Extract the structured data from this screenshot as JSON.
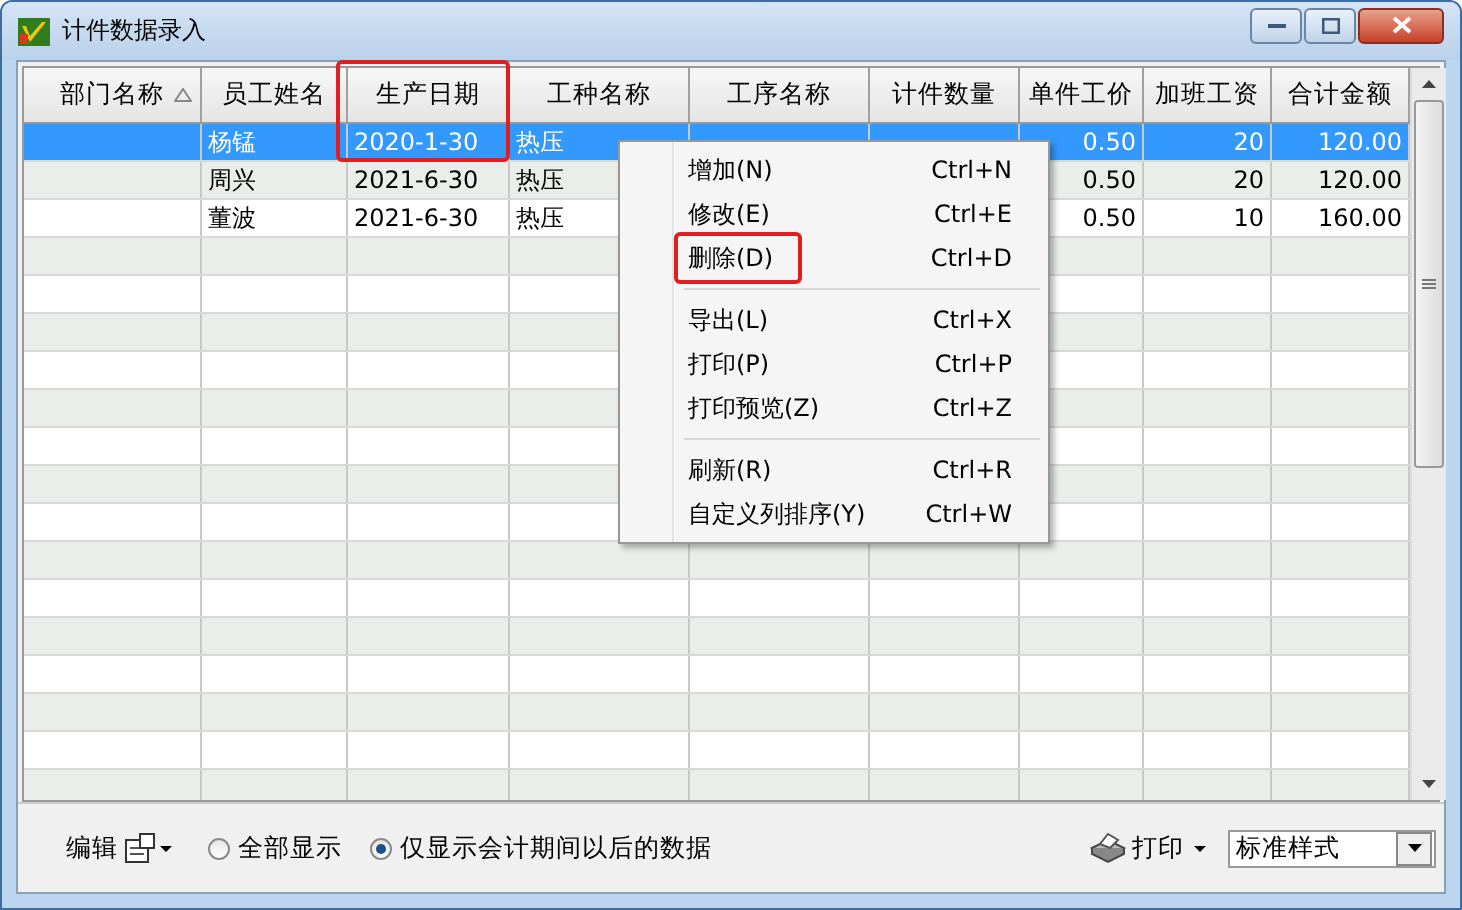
{
  "window": {
    "title": "计件数据录入"
  },
  "table": {
    "columns": [
      {
        "label": "部门名称",
        "sorted": true,
        "highlighted": false
      },
      {
        "label": "员工姓名",
        "sorted": false,
        "highlighted": false
      },
      {
        "label": "生产日期",
        "sorted": false,
        "highlighted": true
      },
      {
        "label": "工种名称",
        "sorted": false,
        "highlighted": false
      },
      {
        "label": "工序名称",
        "sorted": false,
        "highlighted": false
      },
      {
        "label": "计件数量",
        "sorted": false,
        "highlighted": false
      },
      {
        "label": "单件工价",
        "sorted": false,
        "highlighted": false
      },
      {
        "label": "加班工资",
        "sorted": false,
        "highlighted": false
      },
      {
        "label": "合计金额",
        "sorted": false,
        "highlighted": false
      }
    ],
    "rows": [
      {
        "selected": true,
        "cells": [
          null,
          "杨锰",
          "2020-1-30",
          "热压",
          null,
          null,
          "0.50",
          "20",
          "120.00"
        ]
      },
      {
        "selected": false,
        "cells": [
          null,
          "周兴",
          "2021-6-30",
          "热压",
          null,
          null,
          "0.50",
          "20",
          "120.00"
        ]
      },
      {
        "selected": false,
        "cells": [
          null,
          "董波",
          "2021-6-30",
          "热压",
          null,
          null,
          "0.50",
          "10",
          "160.00"
        ]
      }
    ]
  },
  "context_menu": {
    "groups": [
      [
        {
          "label": "增加(N)",
          "shortcut": "Ctrl+N",
          "highlighted": false
        },
        {
          "label": "修改(E)",
          "shortcut": "Ctrl+E",
          "highlighted": false
        },
        {
          "label": "删除(D)",
          "shortcut": "Ctrl+D",
          "highlighted": true
        }
      ],
      [
        {
          "label": "导出(L)",
          "shortcut": "Ctrl+X",
          "highlighted": false
        },
        {
          "label": "打印(P)",
          "shortcut": "Ctrl+P",
          "highlighted": false
        },
        {
          "label": "打印预览(Z)",
          "shortcut": "Ctrl+Z",
          "highlighted": false
        }
      ],
      [
        {
          "label": "刷新(R)",
          "shortcut": "Ctrl+R",
          "highlighted": false
        },
        {
          "label": "自定义列排序(Y)",
          "shortcut": "Ctrl+W",
          "highlighted": false
        }
      ]
    ]
  },
  "footer": {
    "edit_button": "编辑",
    "radios": [
      {
        "label": "全部显示",
        "selected": false
      },
      {
        "label": "仅显示会计期间以后的数据",
        "selected": true
      }
    ],
    "print_button": "打印",
    "style_select": {
      "value": "标准样式"
    }
  }
}
